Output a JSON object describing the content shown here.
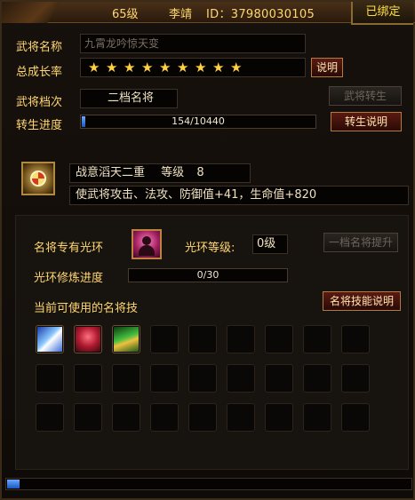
{
  "header": {
    "level": "65级",
    "name": "李靖",
    "id_text": "ID：37980030105",
    "bound_label": "已绑定"
  },
  "general": {
    "name_label": "武将名称",
    "name_placeholder": "九霄龙吟惊天变",
    "growth_label": "总成长率",
    "growth_stars": 9,
    "growth_button": "说明",
    "tier_label": "武将档次",
    "tier_value": "二档名将",
    "rebirth_button": "武将转生",
    "rebirth_progress_label": "转生进度",
    "rebirth_progress_text": "154/10440",
    "rebirth_progress_value": 154,
    "rebirth_progress_max": 10440,
    "rebirth_help_button": "转生说明"
  },
  "battle_intent": {
    "icon": "yin-yang-skill-icon",
    "title": "战意滔天二重",
    "level_label": "等级",
    "level_value": "8",
    "description": "使武将攻击、法攻、防御值+41，生命值+820"
  },
  "aura": {
    "label": "名将专有光环",
    "icon": "general-portrait-icon",
    "level_label": "光环等级:",
    "level_value": "0级",
    "upgrade_button": "一档名将提升",
    "refine_label": "光环修炼进度",
    "refine_text": "0/30",
    "refine_value": 0,
    "refine_max": 30
  },
  "skills": {
    "label": "当前可使用的名将技",
    "help_button": "名将技能说明",
    "filled": [
      {
        "icon": "blue-strike-skill-icon"
      },
      {
        "icon": "red-claw-skill-icon"
      },
      {
        "icon": "green-spear-skill-icon"
      }
    ],
    "slot_count": 27
  },
  "footer": {
    "scroll_fraction": 0.03
  },
  "colors": {
    "label": "#ffd770",
    "progress": "#2a6ad8",
    "star": "#ffd040",
    "accent_button": "#5a1a12"
  }
}
